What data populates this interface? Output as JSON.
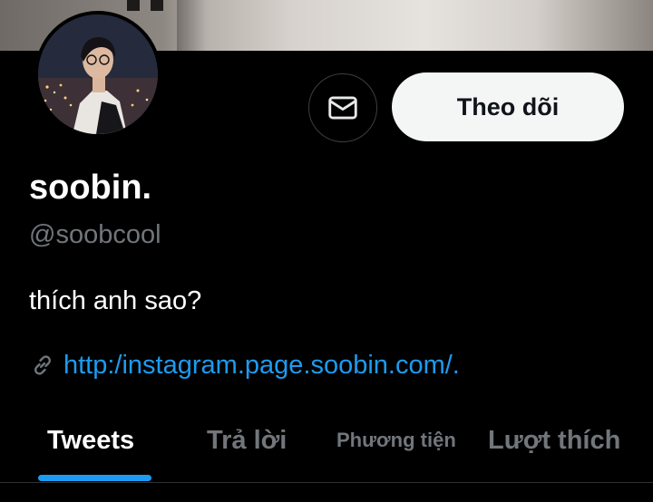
{
  "profile": {
    "display_name": "soobin.",
    "handle": "@soobcool",
    "bio": "thích anh sao?",
    "link": "http:/instagram.page.soobin.com/."
  },
  "actions": {
    "follow_label": "Theo dõi",
    "message_icon": "mail-icon"
  },
  "tabs": [
    {
      "label": "Tweets",
      "active": true
    },
    {
      "label": "Trả lời",
      "active": false
    },
    {
      "label": "Phương tiện",
      "active": false
    },
    {
      "label": "Lượt thích",
      "active": false
    }
  ],
  "colors": {
    "background": "#000000",
    "accent": "#1d9bf0",
    "secondary_text": "#71767b",
    "follow_button_bg": "#f4f5f5"
  }
}
